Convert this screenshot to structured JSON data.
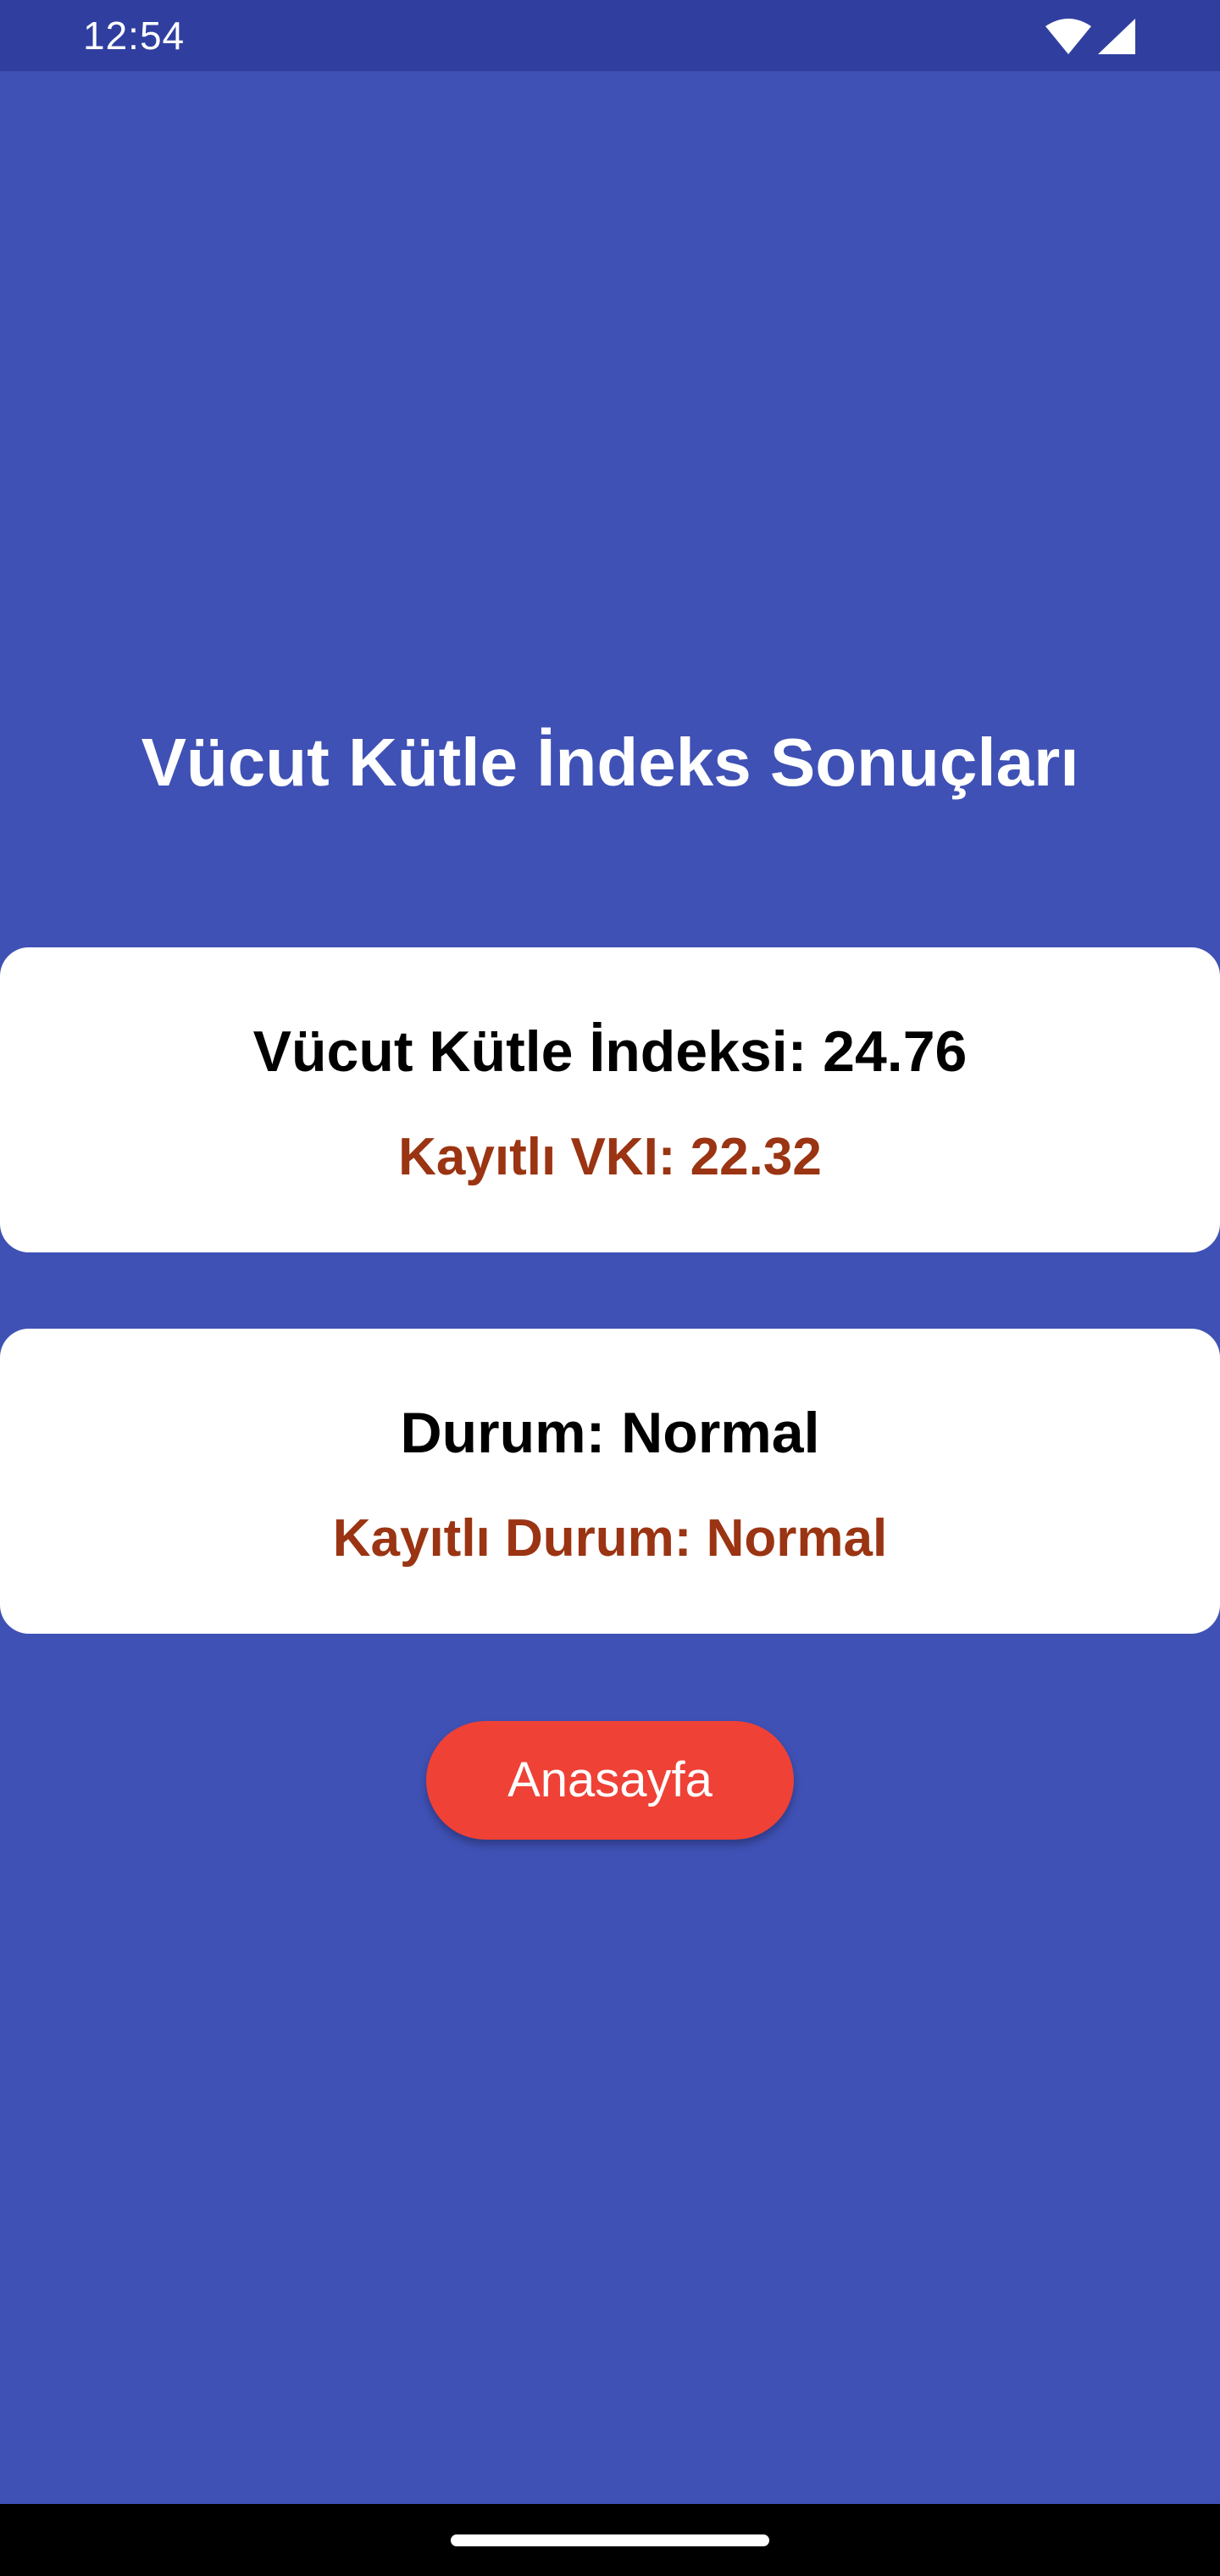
{
  "status_bar": {
    "time": "12:54",
    "icons": [
      "wifi-icon",
      "signal-icon"
    ]
  },
  "page": {
    "title": "Vücut Kütle İndeks Sonuçları"
  },
  "bmi_card": {
    "current": "Vücut Kütle İndeksi: 24.76",
    "saved": "Kayıtlı VKI: 22.32"
  },
  "status_card": {
    "current": "Durum: Normal",
    "saved": "Kayıtlı Durum: Normal"
  },
  "home_button": {
    "label": "Anasayfa"
  },
  "colors": {
    "background": "#3f51b5",
    "status_bar": "#303f9f",
    "card": "#ffffff",
    "saved_text": "#9a3412",
    "button": "#ef4136"
  }
}
